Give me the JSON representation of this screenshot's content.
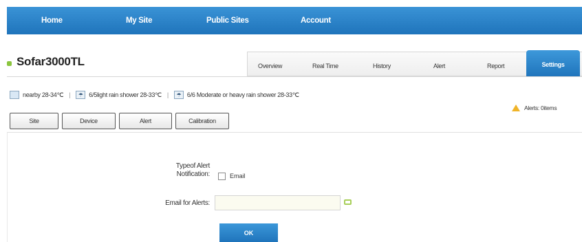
{
  "nav": {
    "items": [
      {
        "label": "Home"
      },
      {
        "label": "My Site"
      },
      {
        "label": "Public Sites"
      },
      {
        "label": "Account"
      }
    ]
  },
  "site": {
    "title": "Sofar3000TL"
  },
  "tabs": [
    {
      "label": "Overview"
    },
    {
      "label": "Real Time"
    },
    {
      "label": "History"
    },
    {
      "label": "Alert"
    },
    {
      "label": "Report"
    },
    {
      "label": "Settings",
      "active": true
    }
  ],
  "weather": {
    "items": [
      {
        "icon": "weather-icon",
        "text": "nearby 28-34℃"
      },
      {
        "icon": "cloud-rain-icon",
        "text": "6/5light rain shower 28-33℃"
      },
      {
        "icon": "cloud-rain-icon",
        "text": "6/6 Moderate or heavy rain shower 28-33℃"
      }
    ],
    "separator": "|"
  },
  "alerts": {
    "text": "Alerts: 0items",
    "icon": "warning-icon"
  },
  "subtabs": [
    {
      "label": "Site"
    },
    {
      "label": "Device"
    },
    {
      "label": "Alert",
      "active": true
    },
    {
      "label": "Calibration"
    }
  ],
  "form": {
    "type_label_line1": "Typeof Alert",
    "type_label_line2": "Notification:",
    "email_option": "Email",
    "email_label": "Email for Alerts:",
    "email_value": "",
    "ok_label": "OK"
  },
  "colors": {
    "accent": "#1f74bb",
    "warning": "#f0b429",
    "add_icon": "#a8cf5a"
  }
}
